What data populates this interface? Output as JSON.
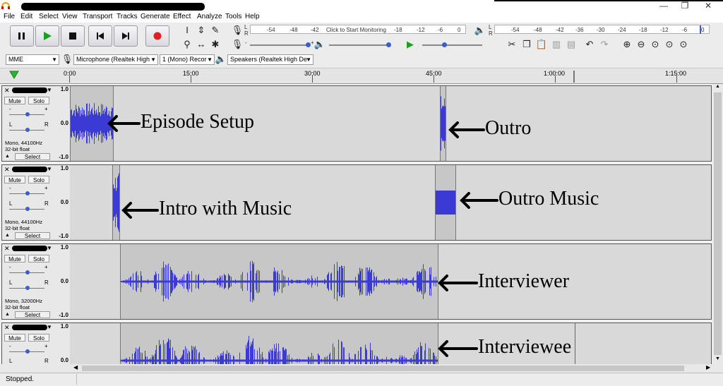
{
  "menu": [
    "File",
    "Edit",
    "Select",
    "View",
    "Transport",
    "Tracks",
    "Generate",
    "Effect",
    "Analyze",
    "Tools",
    "Help"
  ],
  "window_controls": {
    "minimize": "—",
    "restore": "❐",
    "close": "✕"
  },
  "meters": {
    "record_scale": [
      "-54",
      "-48",
      "-42",
      "Click to Start Monitoring",
      "-18",
      "-12",
      "-6",
      "0"
    ],
    "play_scale": [
      "-54",
      "-48",
      "-42",
      "-36",
      "-30",
      "-24",
      "-18",
      "-12",
      "-6",
      "0"
    ],
    "lr_left": "L",
    "lr_right": "R"
  },
  "device": {
    "host": "MME",
    "input": "Microphone (Realtek High",
    "channels": "1 (Mono) Recor",
    "output": "Speakers (Realtek High De"
  },
  "ruler": [
    "0:00",
    "15:00",
    "30:00",
    "45:00",
    "1:00:00",
    "1:15:00"
  ],
  "scale": {
    "top": "1.0",
    "mid": "0.0",
    "bottom": "-1.0"
  },
  "tracks": [
    {
      "close": "✕",
      "mute": "Mute",
      "solo": "Solo",
      "gain_minus": "-",
      "gain_plus": "+",
      "pan_l": "L",
      "pan_r": "R",
      "info1": "Mono, 44100Hz",
      "info2": "32-bit float",
      "select": "Select",
      "annotations": [
        "Episode Setup",
        "Outro"
      ]
    },
    {
      "close": "✕",
      "mute": "Mute",
      "solo": "Solo",
      "gain_minus": "-",
      "gain_plus": "+",
      "pan_l": "L",
      "pan_r": "R",
      "info1": "Mono, 44100Hz",
      "info2": "32-bit float",
      "select": "Select",
      "annotations": [
        "Intro with Music",
        "Outro Music"
      ]
    },
    {
      "close": "✕",
      "mute": "Mute",
      "solo": "Solo",
      "gain_minus": "-",
      "gain_plus": "+",
      "pan_l": "L",
      "pan_r": "R",
      "info1": "Mono, 32000Hz",
      "info2": "32-bit float",
      "select": "Select",
      "annotations": [
        "Interviewer"
      ]
    },
    {
      "close": "✕",
      "mute": "Mute",
      "solo": "Solo",
      "gain_minus": "-",
      "gain_plus": "+",
      "pan_l": "L",
      "pan_r": "R",
      "annotations": [
        "Interviewee"
      ]
    }
  ],
  "status": "Stopped.",
  "colors": {
    "waveform": "#3b3bd4",
    "clip": "#c7c7c7",
    "track_bg": "#d9d9d9",
    "record": "#e02020",
    "play": "#1aa01a"
  }
}
